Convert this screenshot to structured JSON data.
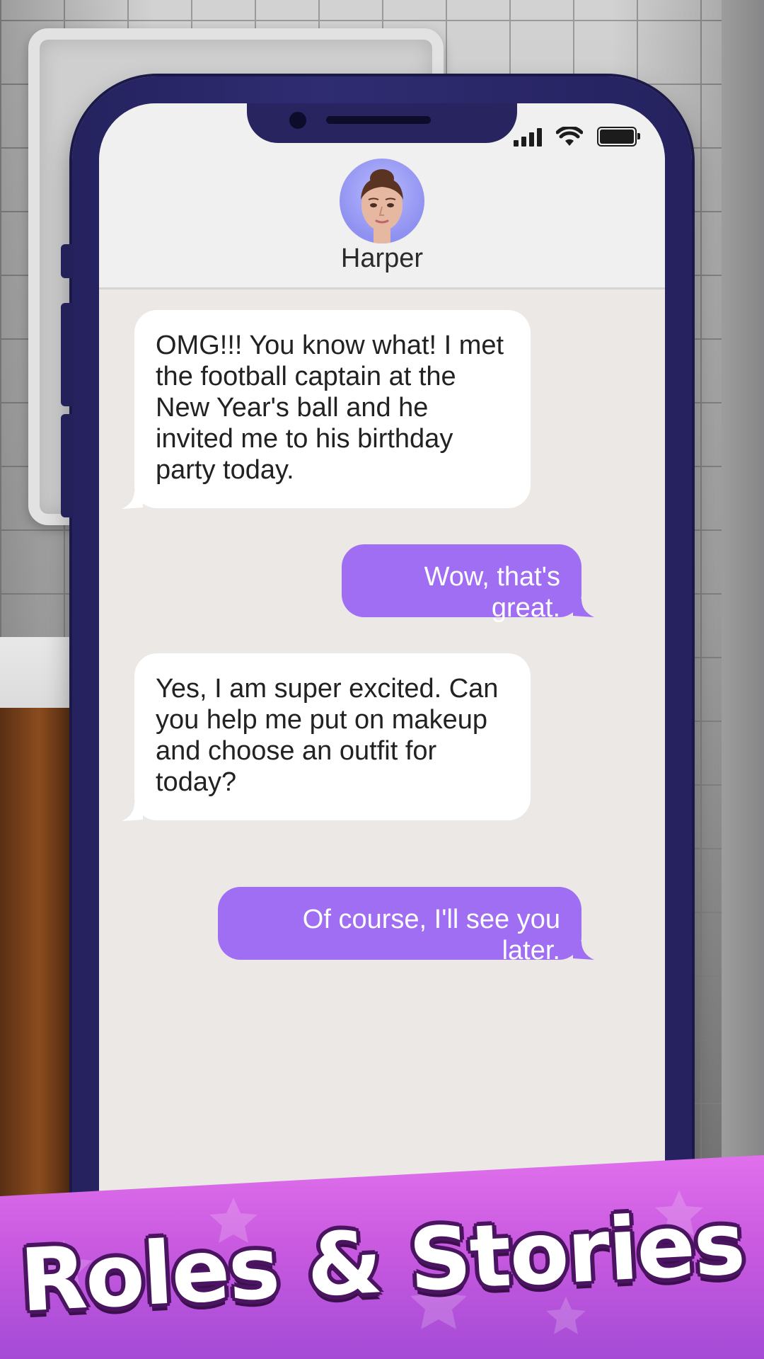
{
  "contact": {
    "name": "Harper"
  },
  "status_bar": {
    "icons": [
      "signal-icon",
      "wifi-icon",
      "battery-icon"
    ],
    "battery_level": 1.0
  },
  "messages": [
    {
      "from": "contact",
      "text": "OMG!!! You know what! I met the football captain at the New Year's ball and he invited me to his birthday party today."
    },
    {
      "from": "user",
      "text": "Wow, that's great."
    },
    {
      "from": "contact",
      "text": "Yes, I am super excited. Can you help me put on makeup and choose an outfit for today?"
    },
    {
      "from": "user",
      "text": "Of course, I'll see you later."
    }
  ],
  "banner": {
    "title": "Roles & Stories"
  },
  "colors": {
    "phone_frame": "#2f2c72",
    "outgoing_bubble": "#a06ef2",
    "incoming_bubble": "#ffffff",
    "banner": "#d667ea"
  }
}
